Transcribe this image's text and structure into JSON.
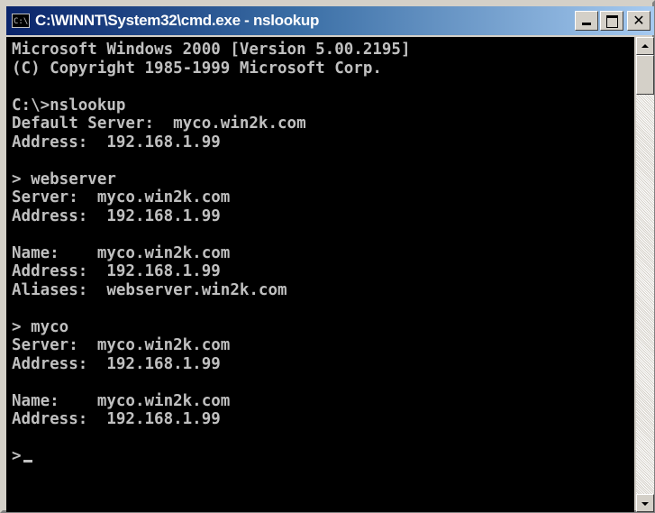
{
  "window": {
    "title": "C:\\WINNT\\System32\\cmd.exe - nslookup",
    "icon_text": "C:\\",
    "buttons": {
      "minimize": "minimize-icon",
      "maximize": "maximize-icon",
      "close_label": "✕"
    }
  },
  "console": {
    "lines": [
      "Microsoft Windows 2000 [Version 5.00.2195]",
      "(C) Copyright 1985-1999 Microsoft Corp.",
      "",
      "C:\\>nslookup",
      "Default Server:  myco.win2k.com",
      "Address:  192.168.1.99",
      "",
      "> webserver",
      "Server:  myco.win2k.com",
      "Address:  192.168.1.99",
      "",
      "Name:    myco.win2k.com",
      "Address:  192.168.1.99",
      "Aliases:  webserver.win2k.com",
      "",
      "> myco",
      "Server:  myco.win2k.com",
      "Address:  192.168.1.99",
      "",
      "Name:    myco.win2k.com",
      "Address:  192.168.1.99",
      "",
      ">"
    ]
  },
  "colors": {
    "console_bg": "#000000",
    "console_fg": "#c0c0c0",
    "titlebar_start": "#0a246a",
    "titlebar_end": "#a6caf0"
  }
}
